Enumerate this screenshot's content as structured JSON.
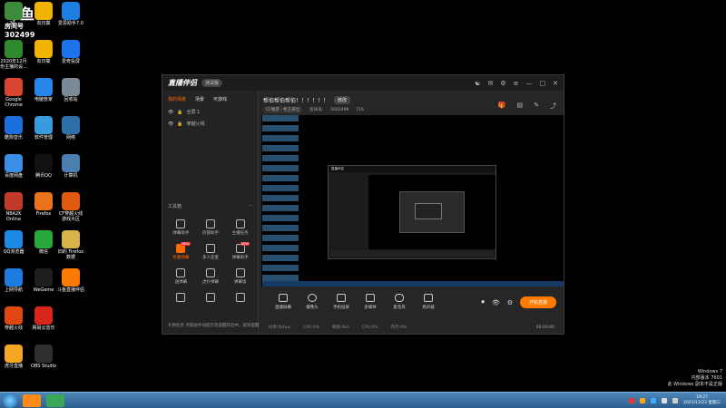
{
  "watermark": {
    "logo": "斗鱼",
    "sub": "房间号",
    "number": "302499"
  },
  "desktop": {
    "icons": [
      {
        "label": "20..",
        "color": "#3a8c3a"
      },
      {
        "label": "向日葵",
        "color": "#f0b400"
      },
      {
        "label": "爱思助手7.0",
        "color": "#1e7de0"
      },
      {
        "label": "2020年12月\n份主播的设...",
        "color": "#2f8a2f"
      },
      {
        "label": "向日葵",
        "color": "#f0b400"
      },
      {
        "label": "爱奇投屏",
        "color": "#1a73e8"
      },
      {
        "label": "Google\nChrome",
        "color": "#d9432f"
      },
      {
        "label": "电脑管家",
        "color": "#2a86e8"
      },
      {
        "label": "回收站",
        "color": "#7a8a99"
      },
      {
        "label": "酷狗音乐",
        "color": "#1a6fdc"
      },
      {
        "label": "软件管理",
        "color": "#3a9bdc"
      },
      {
        "label": "网络",
        "color": "#2d6fa8"
      },
      {
        "label": "百度网盘",
        "color": "#3a8ee8"
      },
      {
        "label": "腾讯QQ",
        "color": "#111111"
      },
      {
        "label": "计算机",
        "color": "#4a7fb0"
      },
      {
        "label": "NBA2K\nOnline",
        "color": "#c23a2a"
      },
      {
        "label": "Firefox",
        "color": "#e8731a"
      },
      {
        "label": "CF穿越火线\n游戏大区",
        "color": "#e05a10"
      },
      {
        "label": "QQ浏览器",
        "color": "#1e88e5"
      },
      {
        "label": "微信",
        "color": "#2aa83a"
      },
      {
        "label": "旧的 Firefox\n数据",
        "color": "#d9b24a"
      },
      {
        "label": "上网导航",
        "color": "#1d7be0"
      },
      {
        "label": "WeGame",
        "color": "#1f1f1f"
      },
      {
        "label": "斗鱼直播伴侣",
        "color": "#ff7a00"
      },
      {
        "label": "穿越火线",
        "color": "#e0460f"
      },
      {
        "label": "网易云音乐",
        "color": "#d9261c"
      },
      {
        "label": "",
        "color": "#000000"
      },
      {
        "label": "虎牙直播",
        "color": "#f5a623"
      },
      {
        "label": "OBS Studio",
        "color": "#302e31"
      }
    ]
  },
  "app": {
    "title": "直播伴侣",
    "version_pill": "测试版",
    "side_tabs": [
      "我的场景",
      "场景",
      "可游戏"
    ],
    "scenes": [
      "全屏 1",
      "穿越火线"
    ],
    "tools_header": "工具箱",
    "tools": [
      {
        "label": "弹幕助手"
      },
      {
        "label": "房管助手"
      },
      {
        "label": "主播任务"
      },
      {
        "label": "有趣弹幕",
        "badge": "NEW"
      },
      {
        "label": "多人连麦"
      },
      {
        "label": "弹幕助手",
        "badge": "NEW"
      },
      {
        "label": "送弹幕"
      },
      {
        "label": "虎扑弹幕"
      },
      {
        "label": "弹幕墙"
      },
      {
        "label": ""
      },
      {
        "label": ""
      },
      {
        "label": ""
      }
    ],
    "side_footer": "礼物任务  点取助手动提示音提醒开启中，取消提醒",
    "live_title": "帮伯帮伯帮伯！！！！！！",
    "edit_label": "修改",
    "meta": {
      "category": "CF端游 - 枪王排位",
      "room_label": "房间号:",
      "room_no": "5002499",
      "hot": "716"
    },
    "inner_title": "直播伴侣",
    "bottom_tools": [
      "直播屏幕",
      "摄像头",
      "手机投屏",
      "多媒体",
      "麦克风",
      "扬声器"
    ],
    "start_label": "开始直播",
    "status": [
      "码率:0kbps",
      "CPU:0%",
      "网络:0kb",
      "CPU:0%",
      "内存:0%"
    ],
    "status_time": "00:00:00"
  },
  "sysinfo": {
    "l1": "Windows 7",
    "l2": "内部版本 7601",
    "l3": "此 Windows 副本不是正版"
  },
  "clock": {
    "time": "19:27",
    "date": "2021/12/22 星期三"
  }
}
